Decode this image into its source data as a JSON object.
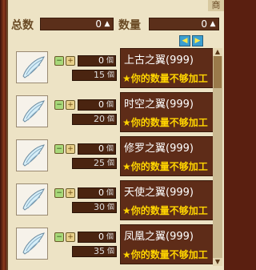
{
  "header": {
    "tab_char": "商",
    "total_label": "总数",
    "total_value": "0",
    "quantity_label": "数量",
    "quantity_value": "0"
  },
  "items": [
    {
      "name": "上古之翼(999)",
      "warning": "★你的数量不够加工",
      "qty": "0",
      "qty_unit": "個",
      "stock": "15",
      "stock_unit": "個",
      "icon": "wing-icon"
    },
    {
      "name": "时空之翼(999)",
      "warning": "★你的数量不够加工",
      "qty": "0",
      "qty_unit": "個",
      "stock": "20",
      "stock_unit": "個",
      "icon": "wing-icon"
    },
    {
      "name": "修罗之翼(999)",
      "warning": "★你的数量不够加工",
      "qty": "0",
      "qty_unit": "個",
      "stock": "25",
      "stock_unit": "個",
      "icon": "wing-icon"
    },
    {
      "name": "天使之翼(999)",
      "warning": "★你的数量不够加工",
      "qty": "0",
      "qty_unit": "個",
      "stock": "30",
      "stock_unit": "個",
      "icon": "wing-icon"
    },
    {
      "name": "凤凰之翼(999)",
      "warning": "★你的数量不够加工",
      "qty": "0",
      "qty_unit": "個",
      "stock": "35",
      "stock_unit": "個",
      "icon": "wing-icon"
    }
  ]
}
